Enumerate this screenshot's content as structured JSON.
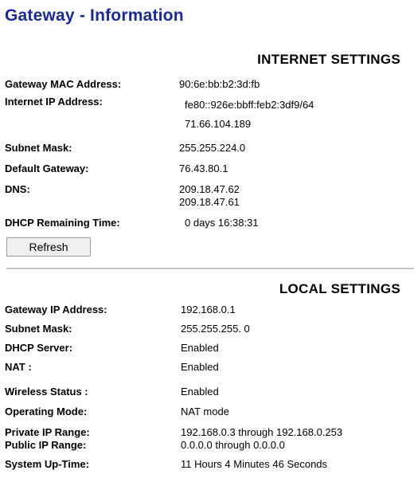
{
  "page": {
    "title": "Gateway - Information"
  },
  "internet": {
    "heading": "INTERNET SETTINGS",
    "rows": {
      "mac_label": "Gateway MAC Address:",
      "mac_value": "90:6e:bb:b2:3d:fb",
      "ip_label": "Internet IP Address:",
      "ip_value_v6": "fe80::926e:bbff:feb2:3df9/64",
      "ip_value_v4": "71.66.104.189",
      "subnet_label": "Subnet Mask:",
      "subnet_value": "255.255.224.0",
      "gateway_label": "Default Gateway:",
      "gateway_value": "76.43.80.1",
      "dns_label": "DNS:",
      "dns_value_1": "209.18.47.62",
      "dns_value_2": "209.18.47.61",
      "dhcp_label": "DHCP Remaining Time:",
      "dhcp_value": "0 days 16:38:31"
    },
    "refresh_label": "Refresh"
  },
  "local": {
    "heading": "LOCAL SETTINGS",
    "rows": {
      "gateway_ip_label": "Gateway IP Address:",
      "gateway_ip_value": "192.168.0.1",
      "subnet_label": "Subnet Mask:",
      "subnet_value": "255.255.255. 0",
      "dhcp_server_label": "DHCP Server:",
      "dhcp_server_value": "Enabled",
      "nat_label": "NAT :",
      "nat_value": "Enabled",
      "wireless_label": "Wireless Status :",
      "wireless_value": "Enabled",
      "operating_mode_label": "Operating Mode:",
      "operating_mode_value": "NAT mode",
      "private_range_label": "Private IP Range:",
      "private_range_value": "192.168.0.3 through 192.168.0.253",
      "public_range_label": "Public IP Range:",
      "public_range_value": "0.0.0.0 through 0.0.0.0",
      "uptime_label": "System Up-Time:",
      "uptime_value": "11 Hours 4 Minutes 46 Seconds"
    }
  }
}
